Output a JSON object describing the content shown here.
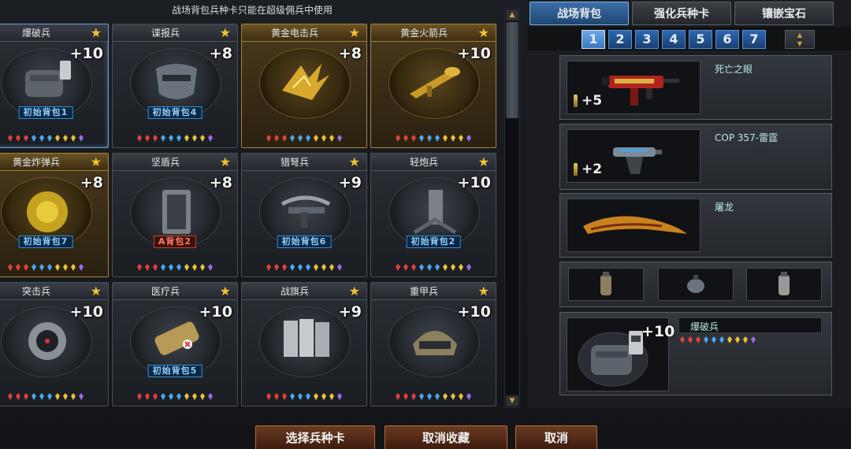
{
  "notice": "战场背包兵种卡只能在超级佣兵中使用",
  "cards": [
    {
      "name": "爆破兵",
      "plus": "+10",
      "tag": "初始背包1",
      "tag_style": "blue",
      "variant": "selected",
      "art": "pack"
    },
    {
      "name": "谍报兵",
      "plus": "+8",
      "tag": "初始背包4",
      "tag_style": "blue",
      "variant": "normal",
      "art": "mask"
    },
    {
      "name": "黄金电击兵",
      "plus": "+8",
      "tag": "",
      "tag_style": "",
      "variant": "gold",
      "art": "claw"
    },
    {
      "name": "黄金火箭兵",
      "plus": "+10",
      "tag": "",
      "tag_style": "",
      "variant": "gold",
      "art": "rocket"
    },
    {
      "name": "黄金炸弹兵",
      "plus": "+8",
      "tag": "初始背包7",
      "tag_style": "blue",
      "variant": "gold",
      "art": "bomb"
    },
    {
      "name": "坚盾兵",
      "plus": "+8",
      "tag": "A背包2",
      "tag_style": "red",
      "variant": "normal",
      "art": "shield"
    },
    {
      "name": "猎弩兵",
      "plus": "+9",
      "tag": "初始背包6",
      "tag_style": "blue",
      "variant": "normal",
      "art": "crossbow"
    },
    {
      "name": "轻炮兵",
      "plus": "+10",
      "tag": "初始背包2",
      "tag_style": "blue",
      "variant": "normal",
      "art": "mortar"
    },
    {
      "name": "突击兵",
      "plus": "+10",
      "tag": "",
      "tag_style": "",
      "variant": "normal",
      "art": "scope"
    },
    {
      "name": "医疗兵",
      "plus": "+10",
      "tag": "初始背包5",
      "tag_style": "blue",
      "variant": "normal",
      "art": "medkit"
    },
    {
      "name": "战旗兵",
      "plus": "+9",
      "tag": "",
      "tag_style": "",
      "variant": "normal",
      "art": "flags"
    },
    {
      "name": "重甲兵",
      "plus": "+10",
      "tag": "",
      "tag_style": "",
      "variant": "normal",
      "art": "helmet"
    }
  ],
  "gem_colors": [
    "#e0413a",
    "#e0413a",
    "#e0413a",
    "#4aa7ee",
    "#4aa7ee",
    "#4aa7ee",
    "#e8c33a",
    "#e8c33a",
    "#e8c33a",
    "#9a6be8"
  ],
  "tabs": [
    "战场背包",
    "强化兵种卡",
    "镶嵌宝石"
  ],
  "pages": [
    "1",
    "2",
    "3",
    "4",
    "5",
    "6",
    "7"
  ],
  "active_page": "1",
  "weapons": [
    {
      "name": "死亡之眼",
      "plus": "+5",
      "art": "smg"
    },
    {
      "name": "COP 357-雷霆",
      "plus": "+2",
      "art": "pistol"
    },
    {
      "name": "屠龙",
      "plus": "",
      "art": "knife"
    }
  ],
  "soldier": {
    "name": "爆破兵",
    "plus": "+10"
  },
  "buttons": {
    "select": "选择兵种卡",
    "unfavorite": "取消收藏",
    "cancel": "取消"
  }
}
